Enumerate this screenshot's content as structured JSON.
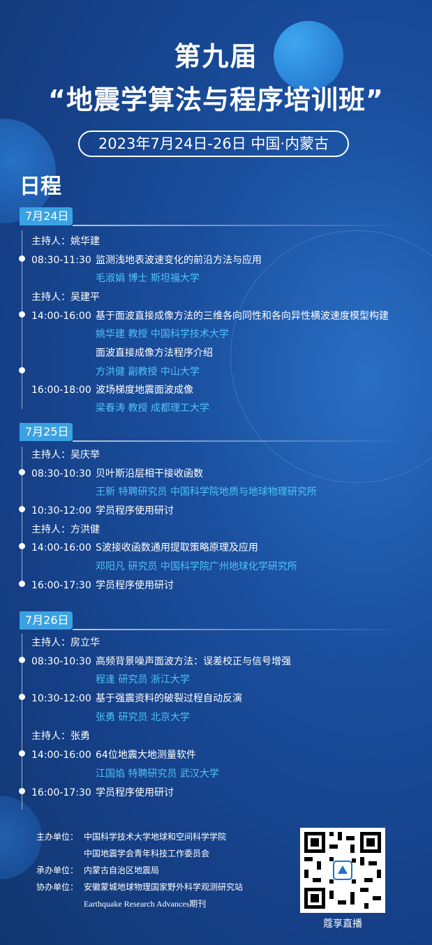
{
  "header": {
    "title_line1": "第九届",
    "title_line2": "“地震学算法与程序培训班”",
    "date_location": "2023年7月24日-26日  中国·内蒙古"
  },
  "schedule_title": "日程",
  "days": [
    {
      "label": "7月24日",
      "items": [
        {
          "host": "主持人：姚华建"
        },
        {
          "time": "08:30-11:30",
          "title": "监测浅地表波速变化的前沿方法与应用",
          "speaker": "毛淑娟 博士  斯坦福大学"
        },
        {
          "host": "主持人：吴建平"
        },
        {
          "time": "14:00-16:00",
          "title": "基于面波直接成像方法的三维各向同性和各向异性横波速度模型构建",
          "speaker": "姚华建 教授  中国科学技术大学",
          "title2": "面波直接成像方法程序介绍",
          "speaker2": "方洪健 副教授  中山大学"
        },
        {
          "time": "16:00-18:00",
          "title": "波场梯度地震面波成像",
          "speaker": "梁春涛 教授  成都理工大学"
        }
      ]
    },
    {
      "label": "7月25日",
      "items": [
        {
          "host": "主持人：吴庆举"
        },
        {
          "time": "08:30-10:30",
          "title": "贝叶斯沿层相干接收函数",
          "speaker": "王新 特聘研究员  中国科学院地质与地球物理研究所"
        },
        {
          "time": "10:30-12:00",
          "title": "学员程序使用研讨"
        },
        {
          "host": "主持人：方洪健"
        },
        {
          "time": "14:00-16:00",
          "title": "S波接收函数通用提取策略原理及应用",
          "speaker": "邓阳凡 研究员  中国科学院广州地球化学研究所"
        },
        {
          "time": "16:00-17:30",
          "title": "学员程序使用研讨"
        }
      ]
    },
    {
      "label": "7月26日",
      "items": [
        {
          "host": "主持人：房立华"
        },
        {
          "time": "08:30-10:30",
          "title": "高频背景噪声面波方法：误差校正与信号增强",
          "speaker": "程逢 研究员  浙江大学"
        },
        {
          "time": "10:30-12:00",
          "title": "基于强震资料的破裂过程自动反演",
          "speaker": "张勇 研究员  北京大学"
        },
        {
          "host": "主持人：张勇"
        },
        {
          "time": "14:00-16:00",
          "title": "64位地震大地测量软件",
          "speaker": "江国焰 特聘研究员  武汉大学"
        },
        {
          "time": "16:00-17:30",
          "title": "学员程序使用研讨"
        }
      ]
    }
  ],
  "organizers": {
    "host_label": "主办单位：",
    "host_1": "中国科学技术大学地球和空间科学学院",
    "host_2": "中国地震学会青年科技工作委员会",
    "co_label": "承办单位：",
    "co_1": "内蒙古自治区地震局",
    "assist_label": "协办单位：",
    "assist_1": "安徽蒙城地球物理国家野外科学观测研究站",
    "assist_2": "Earthquake Research Advances期刊"
  },
  "qr_caption": "蔻享直播",
  "colors": {
    "accent": "#3aa2e3",
    "speaker": "#4fc3f7",
    "background": "#153f86"
  }
}
